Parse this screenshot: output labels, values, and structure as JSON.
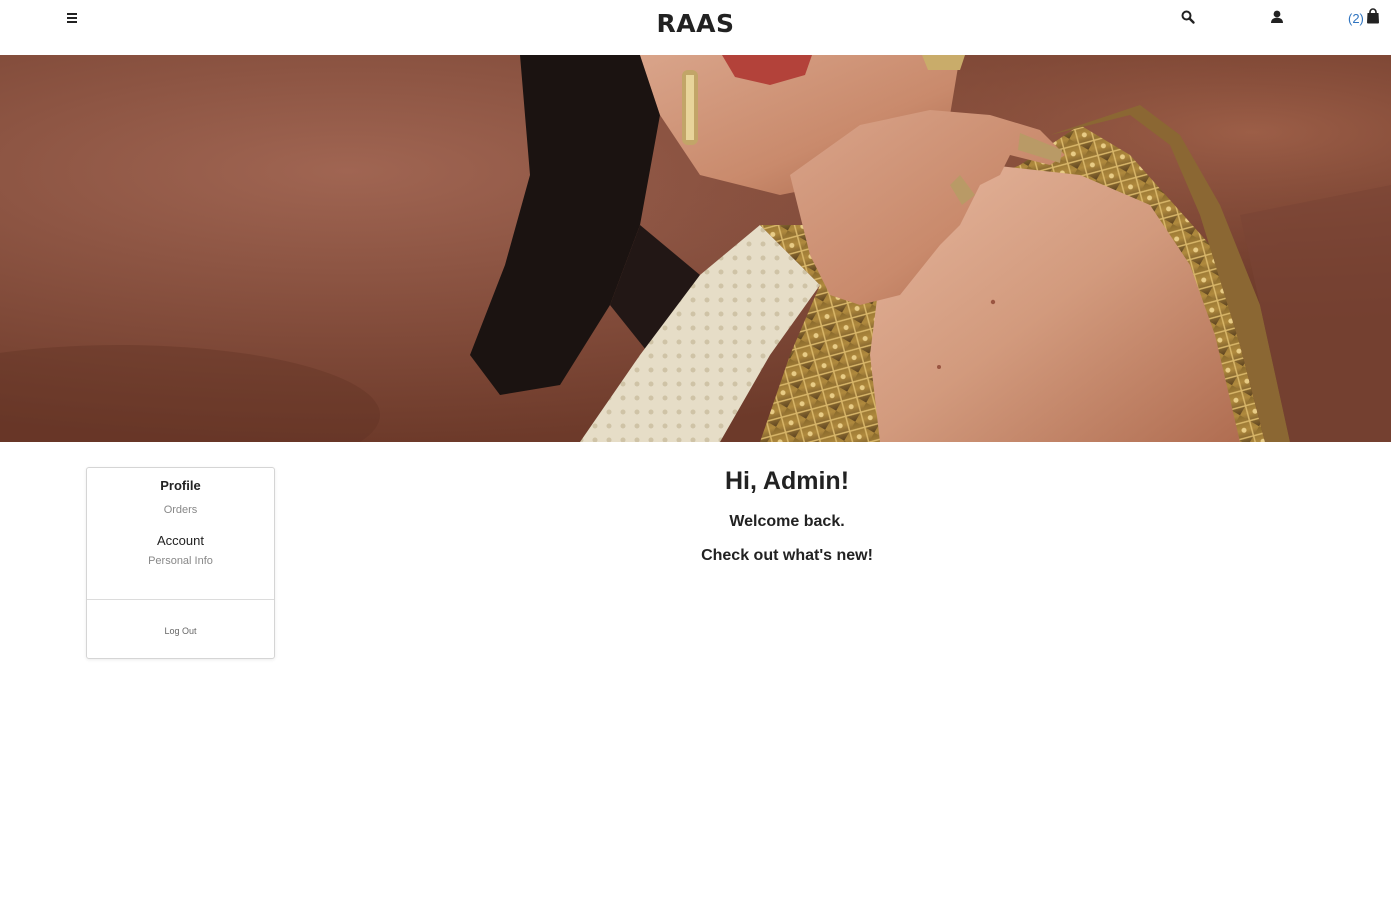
{
  "header": {
    "brand": "RAAS",
    "menu_icon": "hamburger-menu-icon",
    "search_icon": "search-icon",
    "account_icon": "user-icon",
    "cart_icon": "shopping-bag-icon",
    "cart_count": "(2)",
    "accent_color": "#2f74c0"
  },
  "hero": {
    "image": "fashion-model-gold-embellished-outfit"
  },
  "sidebar": {
    "profile_label": "Profile",
    "orders_label": "Orders",
    "account_label": "Account",
    "personal_info_label": "Personal Info",
    "logout_label": "Log Out"
  },
  "main": {
    "greeting": "Hi, Admin!",
    "welcome": "Welcome back.",
    "whats_new": "Check out what's new!"
  }
}
